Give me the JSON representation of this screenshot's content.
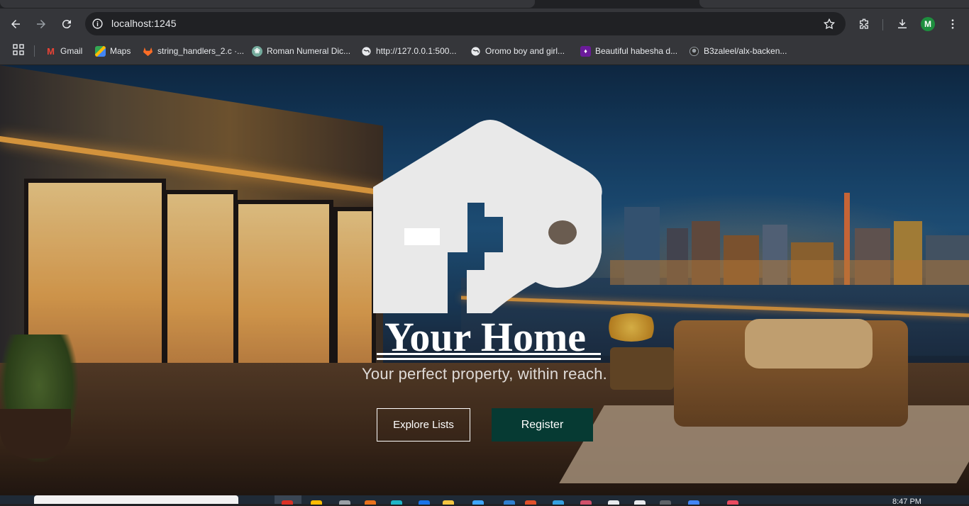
{
  "browser": {
    "url": "localhost:1245",
    "avatar_letter": "M",
    "bookmarks": [
      {
        "label": "Gmail",
        "icon": "gmail-icon"
      },
      {
        "label": "Maps",
        "icon": "maps-icon"
      },
      {
        "label": "string_handlers_2.c ·...",
        "icon": "gitlab-icon"
      },
      {
        "label": "Roman Numeral Dic...",
        "icon": "chatgpt-icon"
      },
      {
        "label": "http://127.0.0.1:500...",
        "icon": "globe-icon"
      },
      {
        "label": "Oromo boy and girl...",
        "icon": "globe-icon"
      },
      {
        "label": "Beautiful habesha d...",
        "icon": "bookmark-purple-icon"
      },
      {
        "label": "B3zaleel/alx-backen...",
        "icon": "github-icon"
      }
    ]
  },
  "hero": {
    "brand": "Your Home",
    "tagline": "Your perfect property, within reach.",
    "explore_label": "Explore Lists",
    "register_label": "Register"
  },
  "taskbar": {
    "clock": "8:47 PM"
  },
  "colors": {
    "register_bg": "#063a33",
    "chrome_bg": "#35363a",
    "omnibox_bg": "#202124",
    "avatar_bg": "#1e8e3e"
  }
}
